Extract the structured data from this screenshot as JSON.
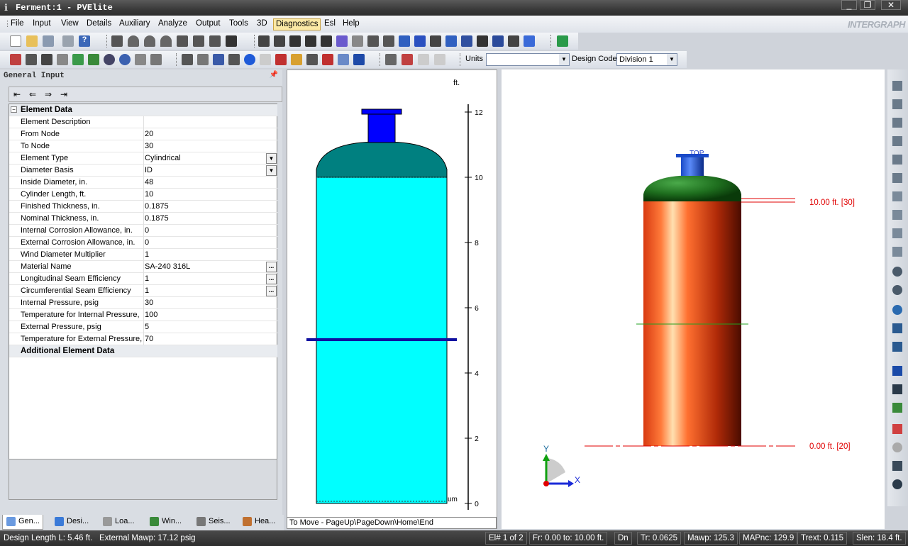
{
  "window": {
    "title": "Ferment:1 - PVElite",
    "brand": "INTERGRAPH"
  },
  "menu": [
    "File",
    "Input",
    "View",
    "Details",
    "Auxiliary",
    "Analyze",
    "Output",
    "Tools",
    "3D",
    "Diagnostics",
    "Esl",
    "Help"
  ],
  "menu_active": "Diagnostics",
  "toolbar": {
    "units_label": "Units",
    "units_value": "",
    "design_code_label": "Design Code",
    "design_code_value": "Division 1"
  },
  "panel": {
    "title": "General Input",
    "group1": "Element Data",
    "group2": "Additional Element Data",
    "rows": [
      {
        "name": "Element Description",
        "value": ""
      },
      {
        "name": "From Node",
        "value": "20"
      },
      {
        "name": "To Node",
        "value": "30"
      },
      {
        "name": "Element Type",
        "value": "Cylindrical",
        "control": "dropdown"
      },
      {
        "name": "Diameter Basis",
        "value": "ID",
        "control": "dropdown"
      },
      {
        "name": "Inside Diameter, in.",
        "value": "48"
      },
      {
        "name": "Cylinder Length, ft.",
        "value": "10"
      },
      {
        "name": "Finished Thickness, in.",
        "value": "0.1875"
      },
      {
        "name": "Nominal Thickness,  in.",
        "value": "0.1875"
      },
      {
        "name": "Internal Corrosion Allowance,  in.",
        "value": "0"
      },
      {
        "name": "External Corrosion Allowance,  in.",
        "value": "0"
      },
      {
        "name": "Wind Diameter Multiplier",
        "value": "1"
      },
      {
        "name": "Material Name",
        "value": "SA-240 316L",
        "control": "ellipsis"
      },
      {
        "name": "Longitudinal Seam Efficiency",
        "value": "1",
        "control": "ellipsis"
      },
      {
        "name": "Circumferential Seam Efficiency",
        "value": "1",
        "control": "ellipsis"
      },
      {
        "name": "Internal Pressure,  psig",
        "value": "30"
      },
      {
        "name": "Temperature for Internal Pressure,",
        "value": "100"
      },
      {
        "name": "External Pressure,  psig",
        "value": "5"
      },
      {
        "name": "Temperature for External Pressure,",
        "value": "70"
      }
    ],
    "ellipsis": "...",
    "tabs": [
      "Gen...",
      "Desi...",
      "Loa...",
      "Win...",
      "Seis...",
      "Hea..."
    ]
  },
  "view2d": {
    "unit_label": "ft.",
    "ticks": [
      "12",
      "10",
      "8",
      "6",
      "4",
      "2",
      "0"
    ],
    "corner_label": "um",
    "hint": "To Move - PageUp\\PageDown\\Home\\End"
  },
  "view3d": {
    "top_label": "TOP",
    "label_top": "10.00 ft.  [30]",
    "label_bottom": "0.00 ft.  [20]",
    "axis_y": "Y",
    "axis_x": "X"
  },
  "status": {
    "design_length": "Design Length L: 5.46 ft.",
    "ext_mawp": "External Mawp: 17.12 psig",
    "element": "El# 1 of 2",
    "from_to": "Fr: 0.00 to: 10.00 ft.",
    "dn": "Dn",
    "tr": "Tr: 0.0625",
    "mawp": "Mawp: 125.3",
    "mapnc": "MAPnc: 129.9",
    "trext": "Trext: 0.115",
    "slen": "Slen: 18.4 ft."
  },
  "colors": {
    "shell2d": "#00ffff",
    "head2d": "#008080",
    "nozzle": "#0000ff",
    "shell3d": "#ff5a1e",
    "head3d": "#1e6e1e",
    "label3d": "#e00000"
  }
}
